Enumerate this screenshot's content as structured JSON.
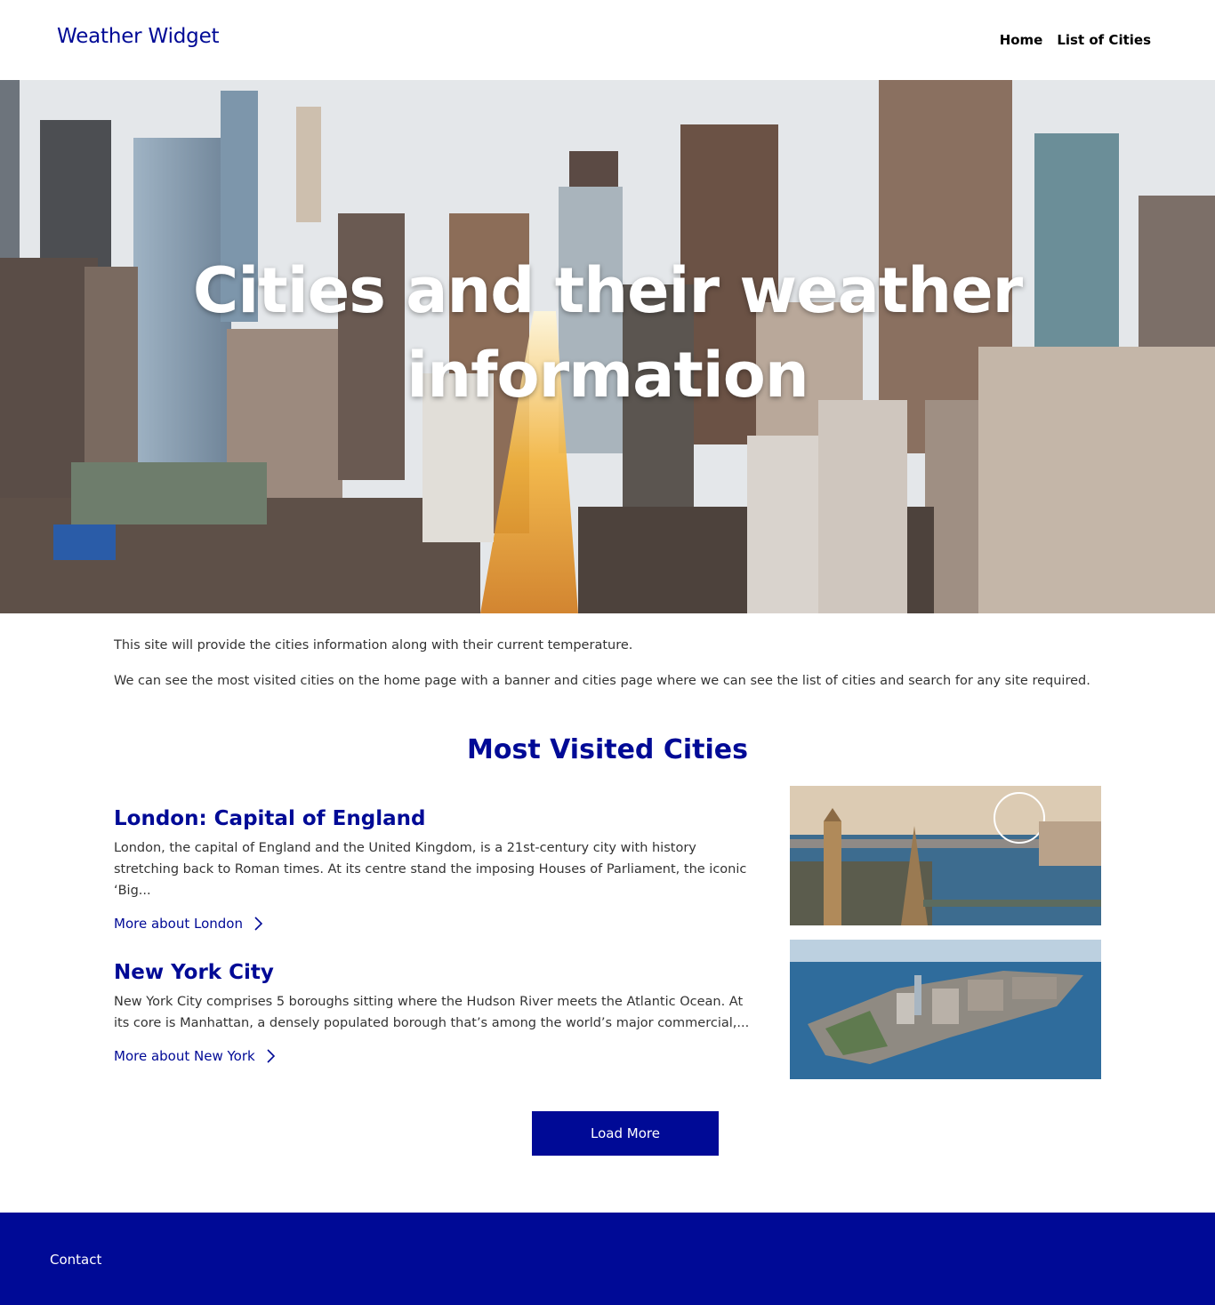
{
  "header": {
    "logo": "Weather Widget",
    "nav": [
      {
        "label": "Home"
      },
      {
        "label": "List of Cities"
      }
    ]
  },
  "hero": {
    "title_line1": "Cities and their weather",
    "title_line2": "information"
  },
  "intro": {
    "p1": "This site will provide the cities information along with their current temperature.",
    "p2": "We can see the most visited cities on the home page with a banner and cities page where we can see the list of cities and search for any site required."
  },
  "section": {
    "title": "Most Visited Cities"
  },
  "cities": [
    {
      "title": "London: Capital of England",
      "description": "London, the capital of England and the United Kingdom, is a 21st-century city with history stretching back to Roman times. At its centre stand the imposing Houses of Parliament, the iconic ‘Big...",
      "link": "More about London"
    },
    {
      "title": "New York City",
      "description": "New York City comprises 5 boroughs sitting where the Hudson River meets the Atlantic Ocean. At its core is Manhattan, a densely populated borough that’s among the world’s major commercial,...",
      "link": "More about New York"
    }
  ],
  "load_more": "Load More",
  "footer": {
    "contact": "Contact"
  },
  "colors": {
    "brand": "#000a96",
    "text": "#333333",
    "white": "#ffffff"
  }
}
